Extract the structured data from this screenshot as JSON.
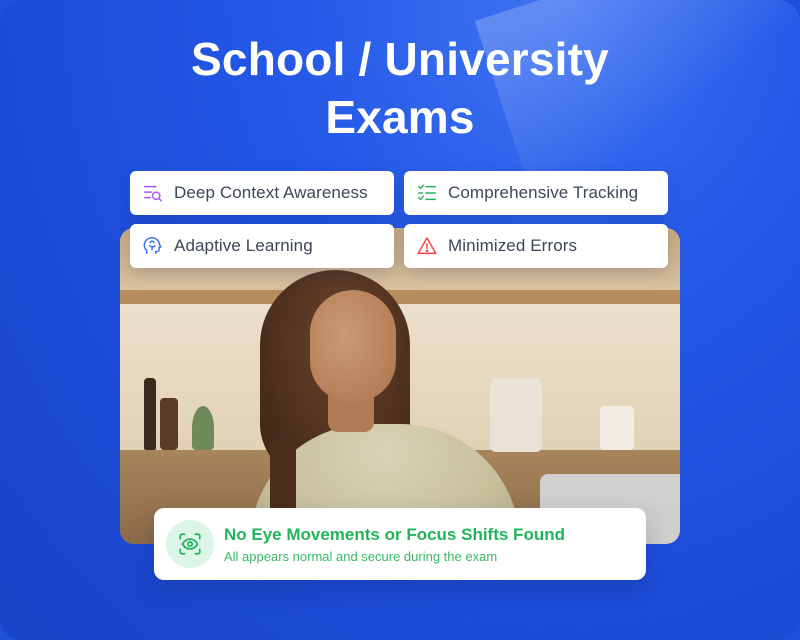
{
  "title": {
    "line1": "School / University",
    "line2": "Exams"
  },
  "features": [
    {
      "label": "Deep Context Awareness",
      "icon": "list-search-icon",
      "color": "#a855f7"
    },
    {
      "label": "Comprehensive Tracking",
      "icon": "checklist-icon",
      "color": "#22b45a"
    },
    {
      "label": "Adaptive Learning",
      "icon": "brain-head-icon",
      "color": "#3b74f0"
    },
    {
      "label": "Minimized Errors",
      "icon": "warning-triangle-icon",
      "color": "#ef4444"
    }
  ],
  "notice": {
    "headline": "No Eye Movements or Focus Shifts Found",
    "subtext": "All appears normal and secure during the exam",
    "icon": "eye-scan-icon",
    "color": "#22b45a"
  },
  "colors": {
    "background": "#2458e6",
    "card": "#ffffff",
    "text": "#3c4659"
  }
}
